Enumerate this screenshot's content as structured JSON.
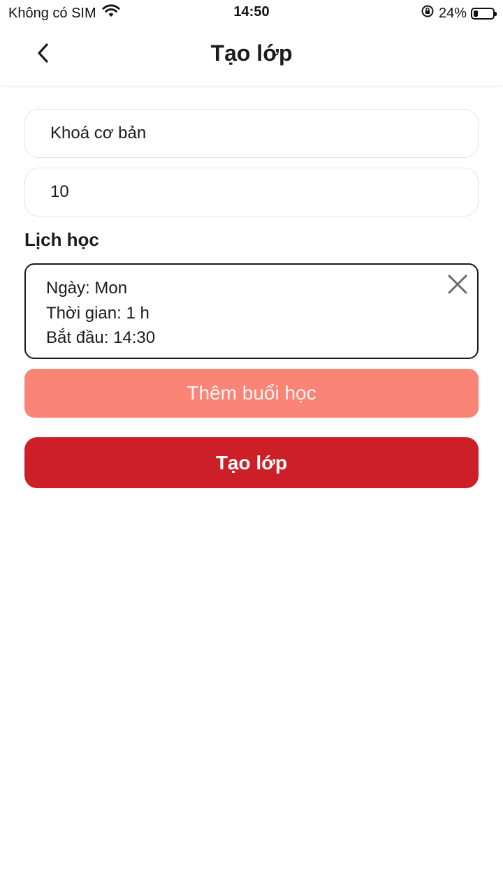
{
  "status_bar": {
    "carrier": "Không có SIM",
    "time": "14:50",
    "battery_percent": "24%",
    "battery_level": 0.24,
    "icons": [
      "wifi-icon",
      "rotation-lock-icon",
      "battery-icon"
    ]
  },
  "header": {
    "title": "Tạo lớp",
    "back_icon": "chevron-left-icon"
  },
  "form": {
    "class_name_value": "Khoá cơ bản",
    "quantity_value": "10"
  },
  "schedule": {
    "section_title": "Lịch học",
    "items": [
      {
        "day": "Ngày: Mon",
        "duration": "Thời gian: 1 h",
        "start": "Bắt đầu: 14:30"
      }
    ],
    "remove_icon": "close-icon"
  },
  "buttons": {
    "add_session": "Thêm buổi học",
    "create_class": "Tạo lớp"
  },
  "colors": {
    "primary": "#cc1f27",
    "secondary": "#fa8475",
    "text": "#1b1b1f",
    "field_border": "#e6e6e8"
  }
}
